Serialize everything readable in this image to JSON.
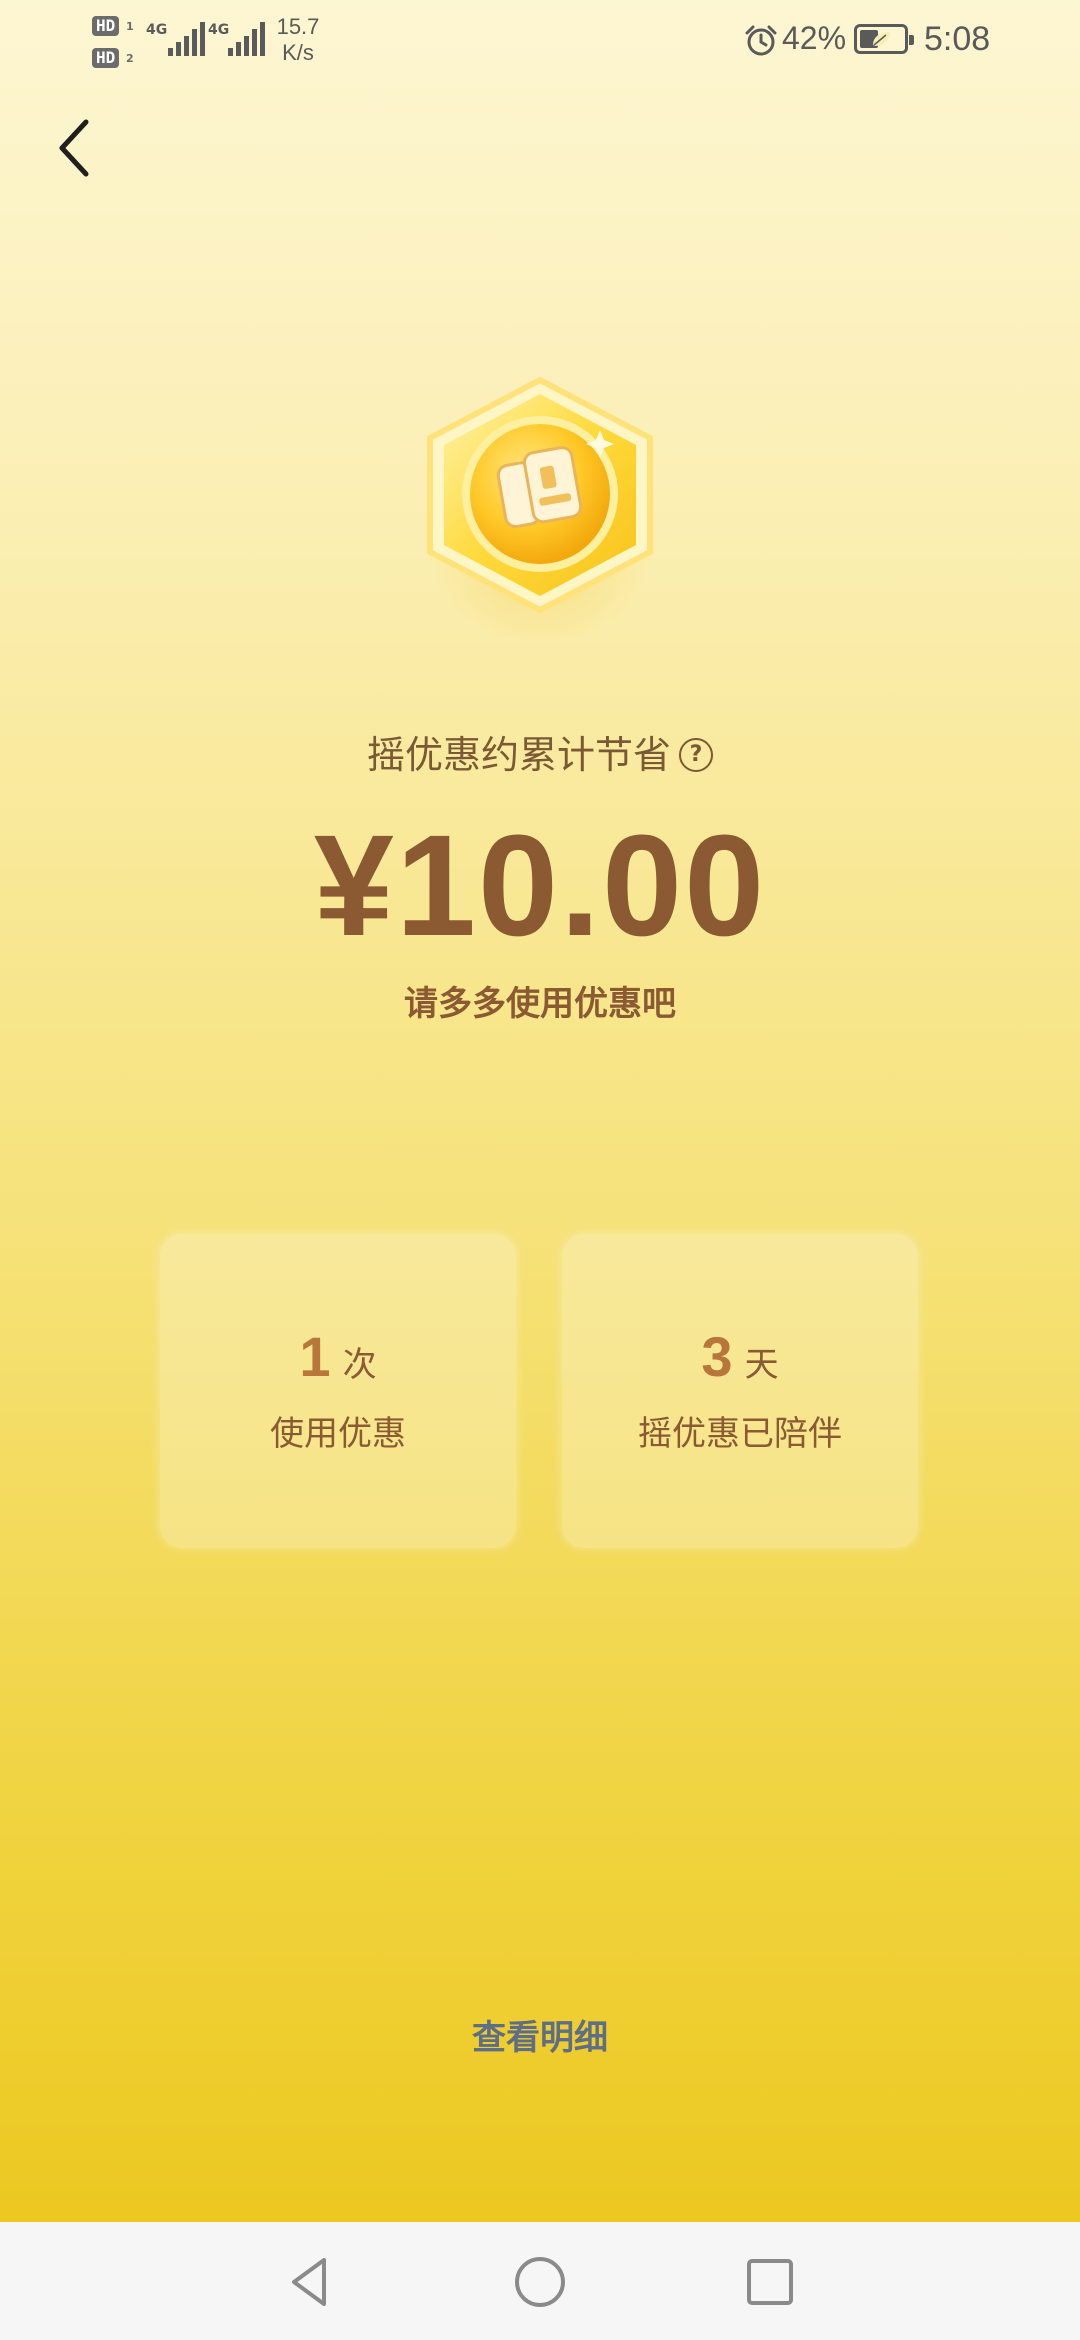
{
  "status_bar": {
    "sim1": "HD",
    "sim1_index": "1",
    "sim2": "HD",
    "sim2_index": "2",
    "network1": "4G",
    "network2": "4G",
    "speed_value": "15.7",
    "speed_unit": "K/s",
    "battery_percent": "42%",
    "battery_level": 0.42,
    "time": "5:08",
    "icons": [
      "alarm-icon",
      "battery-icon",
      "leaf-icon",
      "signal-icon"
    ]
  },
  "header": {
    "back_icon": "chevron-left-icon"
  },
  "summary": {
    "badge_icon": "hexagon-coin-icon",
    "title": "摇优惠约累计节省",
    "help_icon": "?",
    "amount": "¥10.00",
    "tagline": "请多多使用优惠吧"
  },
  "stats": [
    {
      "value": "1",
      "unit": "次",
      "label": "使用优惠"
    },
    {
      "value": "3",
      "unit": "天",
      "label": "摇优惠已陪伴"
    }
  ],
  "footer": {
    "detail_link": "查看明细"
  },
  "navigation_bar": {
    "buttons": [
      "back-triangle-icon",
      "home-circle-icon",
      "recents-square-icon"
    ]
  },
  "colors": {
    "amount_text": "#8b5a33",
    "stat_number": "#b8763a",
    "link_text": "#5d6e86",
    "background_top": "#fdf6d2",
    "background_bottom": "#ecc820"
  }
}
